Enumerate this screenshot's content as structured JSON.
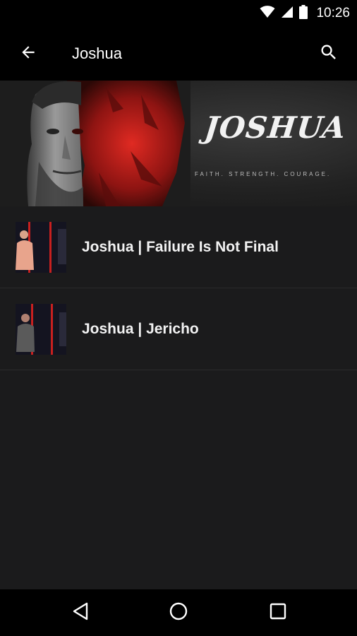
{
  "status_bar": {
    "time": "10:26",
    "icons": [
      "wifi-icon",
      "signal-icon",
      "battery-icon"
    ]
  },
  "app_bar": {
    "title": "Joshua",
    "back_icon": "arrow-back-icon",
    "search_icon": "search-icon"
  },
  "banner": {
    "title": "JOSHUA",
    "tagline": "FAITH. STRENGTH. COURAGE.",
    "accent_color": "#c8201f"
  },
  "items": [
    {
      "title": "Joshua | Failure Is Not Final",
      "thumbnail_icon": "sermon-thumbnail"
    },
    {
      "title": "Joshua | Jericho",
      "thumbnail_icon": "sermon-thumbnail"
    }
  ],
  "nav_bar": {
    "icons": [
      "back-triangle-icon",
      "home-circle-icon",
      "recents-square-icon"
    ]
  },
  "colors": {
    "background": "#1b1b1c",
    "bars": "#000000",
    "text": "#f2f2f2",
    "divider": "#2b2b2c"
  }
}
